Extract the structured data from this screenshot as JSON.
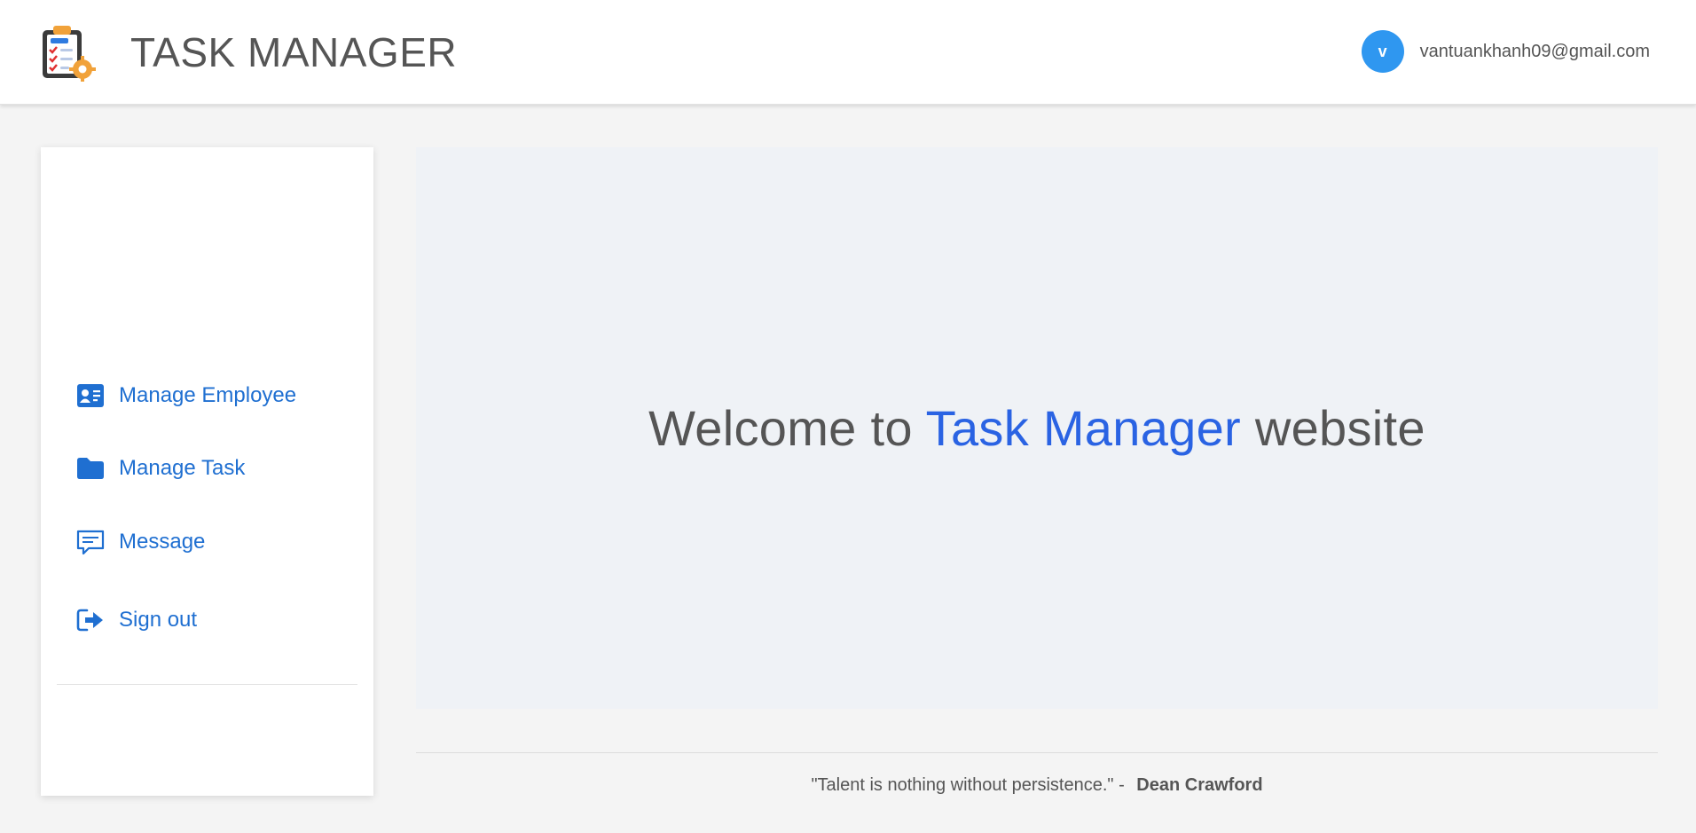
{
  "header": {
    "app_title": "TASK MANAGER",
    "logo_icon": "clipboard-checklist-gear-icon",
    "user": {
      "avatar_initial": "v",
      "avatar_color": "#2f97f0",
      "email": "vantuankhanh09@gmail.com"
    }
  },
  "sidebar": {
    "items": [
      {
        "label": "Manage Employee",
        "icon": "id-card-icon"
      },
      {
        "label": "Manage Task",
        "icon": "folder-icon"
      },
      {
        "label": "Message",
        "icon": "message-icon"
      }
    ],
    "signout_label": "Sign out",
    "signout_icon": "sign-out-icon",
    "accent_color": "#1f6fd1"
  },
  "main": {
    "welcome_prefix": "Welcome to",
    "welcome_accent": "Task Manager",
    "welcome_suffix": "website",
    "accent_color": "#2a63e3"
  },
  "footer": {
    "quote": "\"Talent is nothing without persistence.\" -",
    "author": "Dean Crawford"
  }
}
